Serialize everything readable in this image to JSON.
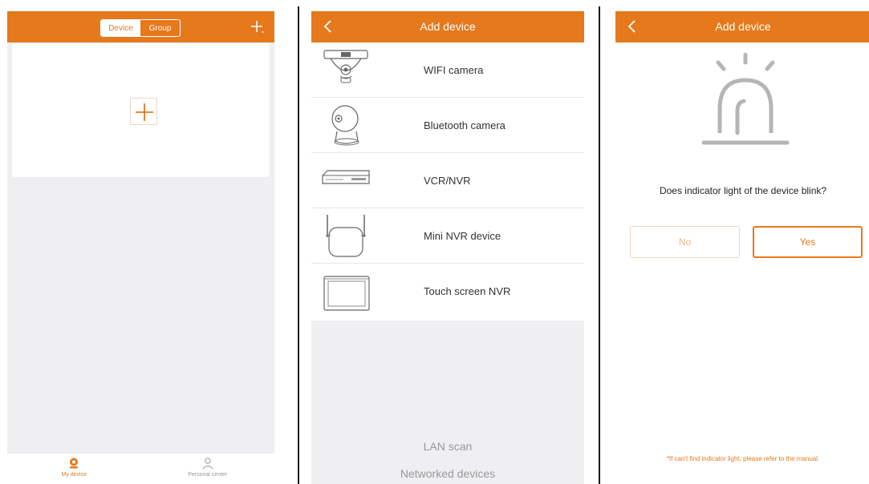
{
  "colors": {
    "accent": "#e5791c",
    "background_grey": "#efeff2",
    "white": "#ffffff"
  },
  "screen1": {
    "segment": {
      "device_label": "Device",
      "group_label": "Group",
      "selected": "Device"
    },
    "add_icon": "plus-icon",
    "tabbar": [
      {
        "label": "My device",
        "icon": "camera-icon",
        "active": true
      },
      {
        "label": "Personal center",
        "icon": "person-icon",
        "active": false
      }
    ]
  },
  "screen2": {
    "title": "Add device",
    "devices": [
      {
        "label": "WIFI camera",
        "icon": "wifi-camera-icon"
      },
      {
        "label": "Bluetooth camera",
        "icon": "bluetooth-camera-icon"
      },
      {
        "label": "VCR/NVR",
        "icon": "nvr-box-icon"
      },
      {
        "label": "Mini NVR device",
        "icon": "mini-nvr-icon"
      },
      {
        "label": "Touch screen NVR",
        "icon": "touch-screen-nvr-icon"
      }
    ],
    "lan_scan": "LAN scan",
    "networked_devices": "Networked devices"
  },
  "screen3": {
    "title": "Add device",
    "question": "Does indicator light of the device blink?",
    "no_label": "No",
    "yes_label": "Yes",
    "hint": "*If can't find indicator light, please refer to the manual."
  }
}
